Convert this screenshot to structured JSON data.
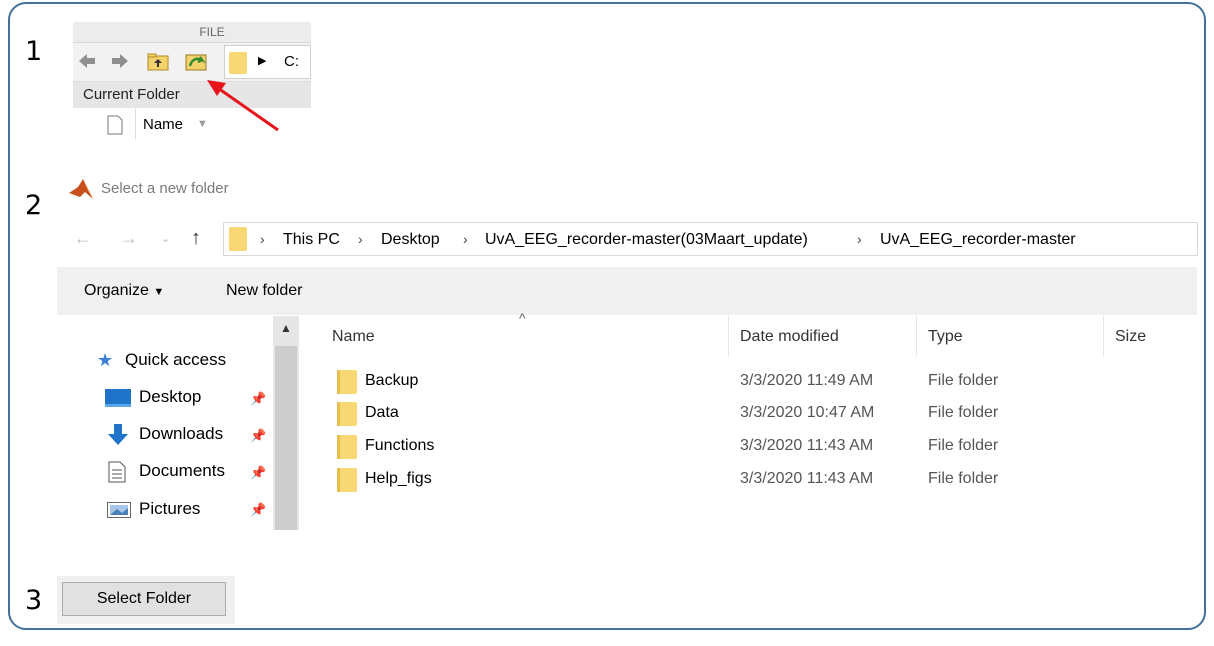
{
  "steps": [
    "1",
    "2",
    "3"
  ],
  "matlab": {
    "tab_label": "FILE",
    "path_text": "C:",
    "current_folder_label": "Current Folder",
    "name_column_label": "Name",
    "icons": [
      "back-arrow-icon",
      "forward-arrow-icon",
      "up-one-level-icon",
      "browse-folder-icon",
      "folder-icon"
    ],
    "annotation_color": "#e8141b"
  },
  "dialog": {
    "title": "Select a new folder",
    "breadcrumb": [
      "This PC",
      "Desktop",
      "UvA_EEG_recorder-master(03Maart_update)",
      "UvA_EEG_recorder-master"
    ],
    "toolbar": {
      "organize_label": "Organize",
      "new_folder_label": "New folder"
    },
    "nav_items": [
      {
        "label": "Quick access",
        "icon": "star-icon",
        "pinned": false
      },
      {
        "label": "Desktop",
        "icon": "desktop-icon",
        "pinned": true
      },
      {
        "label": "Downloads",
        "icon": "download-icon",
        "pinned": true
      },
      {
        "label": "Documents",
        "icon": "documents-icon",
        "pinned": true
      },
      {
        "label": "Pictures",
        "icon": "pictures-icon",
        "pinned": true
      }
    ],
    "columns": {
      "name": "Name",
      "date": "Date modified",
      "type": "Type",
      "size": "Size"
    },
    "rows": [
      {
        "name": "Backup",
        "date": "3/3/2020 11:49 AM",
        "type": "File folder"
      },
      {
        "name": "Data",
        "date": "3/3/2020 10:47 AM",
        "type": "File folder"
      },
      {
        "name": "Functions",
        "date": "3/3/2020 11:43 AM",
        "type": "File folder"
      },
      {
        "name": "Help_figs",
        "date": "3/3/2020 11:43 AM",
        "type": "File folder"
      }
    ]
  },
  "select_button_label": "Select Folder",
  "colors": {
    "frame": "#41719c",
    "folder": "#f8d775",
    "arrow": "#e8141b",
    "star": "#3b7fd6"
  }
}
